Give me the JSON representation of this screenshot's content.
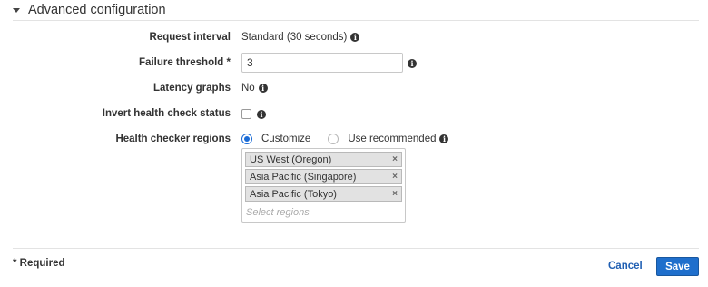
{
  "section": {
    "title": "Advanced configuration",
    "expanded": true,
    "icon": "caret-down-icon"
  },
  "fields": {
    "request_interval": {
      "label": "Request interval",
      "value": "Standard (30 seconds)",
      "info_icon": "info-icon"
    },
    "failure_threshold": {
      "label": "Failure threshold *",
      "value": "3",
      "info_icon": "info-icon"
    },
    "latency_graphs": {
      "label": "Latency graphs",
      "value": "No",
      "info_icon": "info-icon"
    },
    "invert_health": {
      "label": "Invert health check status",
      "checked": false,
      "info_icon": "info-icon"
    },
    "regions": {
      "label": "Health checker regions",
      "options": [
        {
          "label": "Customize",
          "selected": true
        },
        {
          "label": "Use recommended",
          "selected": false
        }
      ],
      "selected_regions": [
        "US West (Oregon)",
        "Asia Pacific (Singapore)",
        "Asia Pacific (Tokyo)"
      ],
      "remove_glyph": "×",
      "placeholder": "Select regions",
      "info_icon": "info-icon"
    }
  },
  "footer": {
    "required_note": "* Required",
    "cancel_label": "Cancel",
    "save_label": "Save"
  },
  "colors": {
    "accent": "#1f6fcc",
    "link": "#1f5fb3"
  }
}
